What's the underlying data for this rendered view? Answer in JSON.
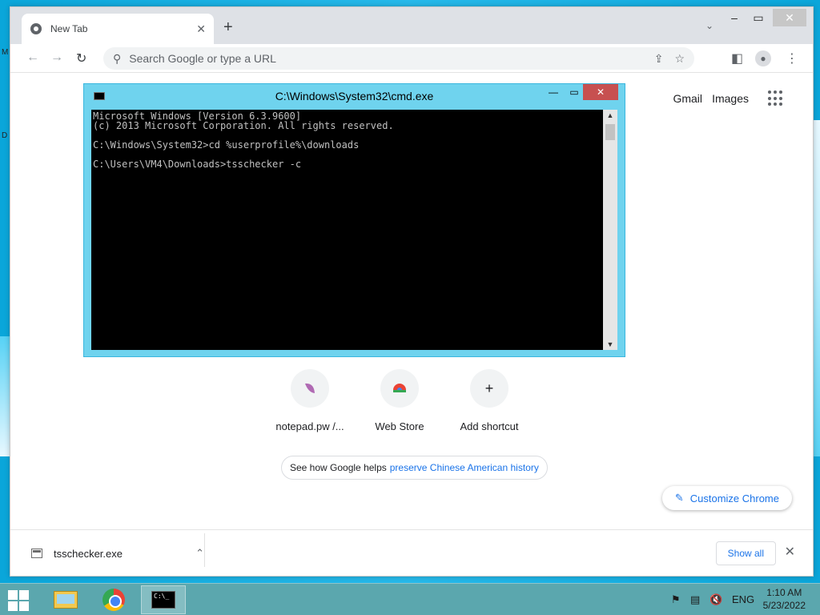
{
  "browser": {
    "tab_title": "New Tab",
    "omnibox_placeholder": "Search Google or type a URL",
    "top_links": [
      "Gmail",
      "Images"
    ],
    "shortcuts": [
      {
        "label": "notepad.pw /..."
      },
      {
        "label": "Web Store"
      },
      {
        "label": "Add shortcut"
      }
    ],
    "promo_text": "See how Google helps",
    "promo_link": "preserve Chinese American history",
    "customize_label": "Customize Chrome"
  },
  "downloads": {
    "file_name": "tsschecker.exe",
    "show_all_label": "Show all"
  },
  "cmd": {
    "title": "C:\\Windows\\System32\\cmd.exe",
    "console_text": "Microsoft Windows [Version 6.3.9600]\n(c) 2013 Microsoft Corporation. All rights reserved.\n\nC:\\Windows\\System32>cd %userprofile%\\downloads\n\nC:\\Users\\VM4\\Downloads>tsschecker -c"
  },
  "taskbar": {
    "language": "ENG",
    "time": "1:10 AM",
    "date": "5/23/2022"
  },
  "colors": {
    "accent": "#1a73e8",
    "cmd_frame": "#6fd3ee",
    "taskbar": "#5ba7ae"
  }
}
